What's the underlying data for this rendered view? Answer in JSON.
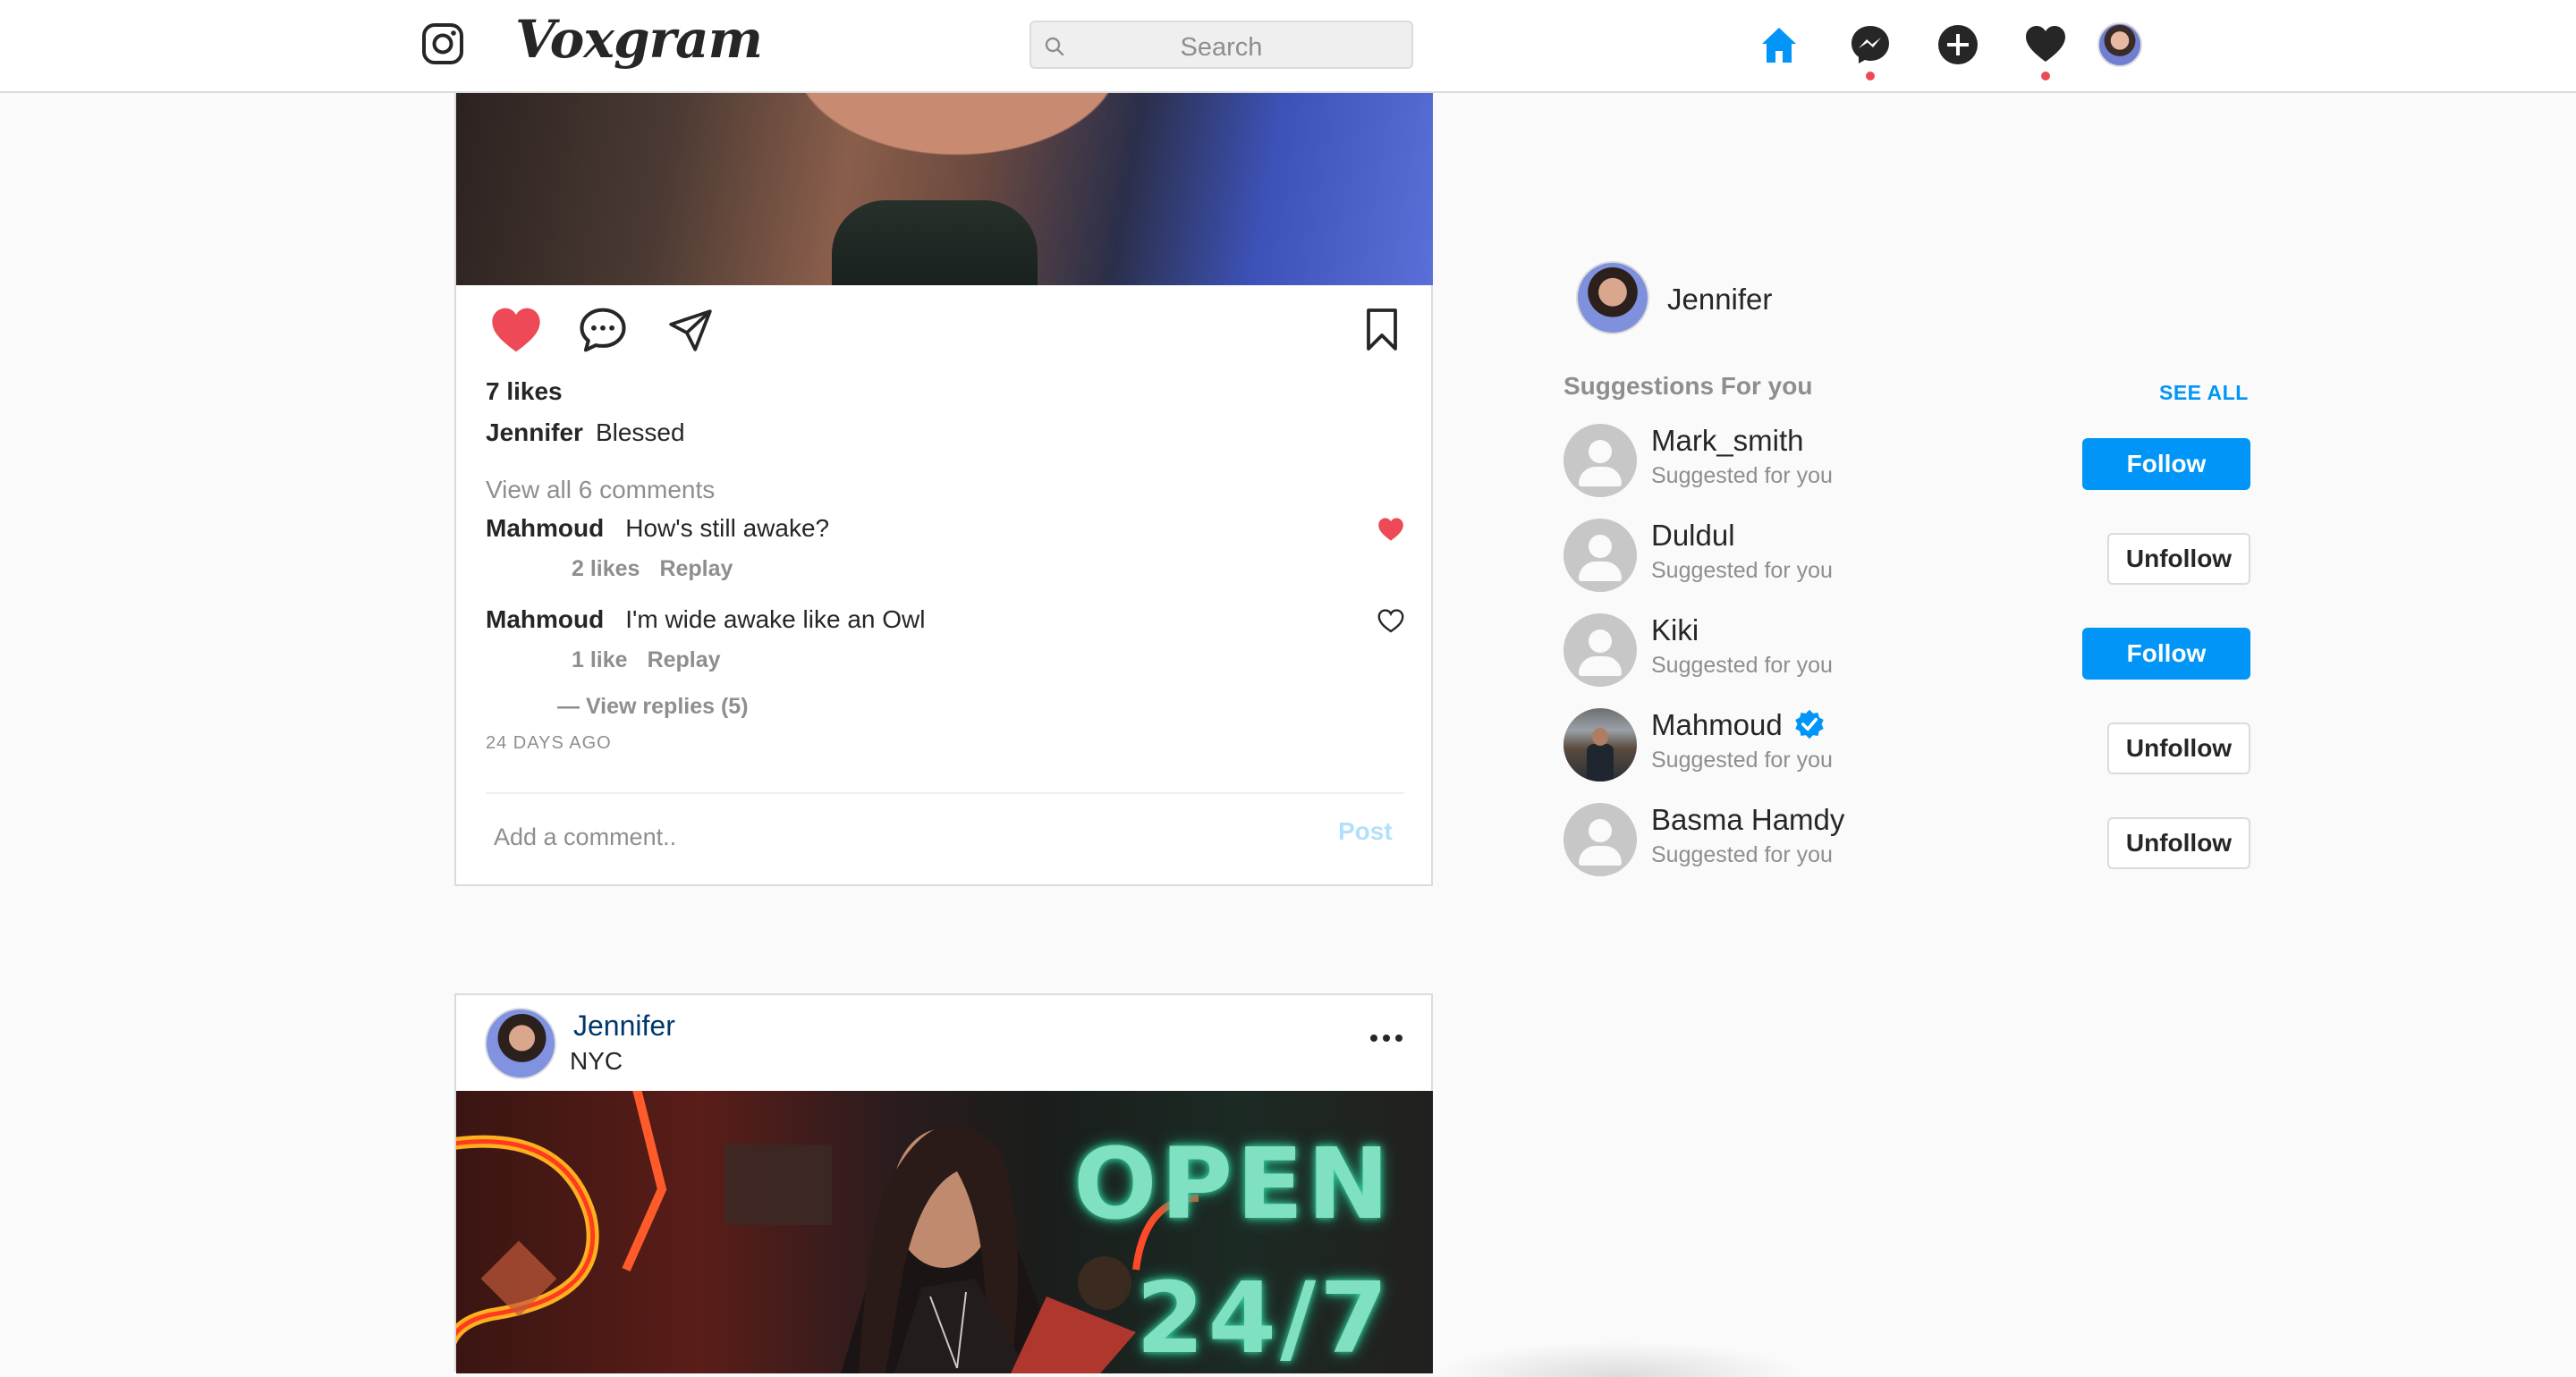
{
  "app": {
    "name": "Voxgram"
  },
  "search": {
    "placeholder": "Search"
  },
  "nav": {
    "icons": [
      "home-icon",
      "messenger-icon",
      "create-icon",
      "activity-heart-icon",
      "profile-avatar"
    ]
  },
  "post1": {
    "likes": "7 likes",
    "caption_user": "Jennifer",
    "caption_text": "Blessed",
    "view_all": "View all 6 comments",
    "comments": [
      {
        "user": "Mahmoud",
        "text": "How's still awake?",
        "likes": "2 likes",
        "reply": "Replay",
        "liked": true
      },
      {
        "user": "Mahmoud",
        "text": "I'm wide awake like an Owl",
        "likes": "1 like",
        "reply": "Replay",
        "liked": false
      }
    ],
    "view_replies": "— View replies (5)",
    "time_ago": "24 DAYS AGO",
    "add_comment_placeholder": "Add a comment..",
    "post_label": "Post"
  },
  "post2": {
    "user": "Jennifer",
    "location": "NYC",
    "sign_text_1": "OPEN",
    "sign_text_2": "24/7"
  },
  "sidebar": {
    "current_user": "Jennifer",
    "suggestions_title": "Suggestions For you",
    "see_all": "SEE ALL",
    "suggestions": [
      {
        "name": "Mark_smith",
        "sub": "Suggested for you",
        "action": "Follow",
        "verified": false
      },
      {
        "name": "Duldul",
        "sub": "Suggested for you",
        "action": "Unfollow",
        "verified": false
      },
      {
        "name": "Kiki",
        "sub": "Suggested for you",
        "action": "Follow",
        "verified": false
      },
      {
        "name": "Mahmoud",
        "sub": "Suggested for you",
        "action": "Unfollow",
        "verified": true
      },
      {
        "name": "Basma Hamdy",
        "sub": "Suggested for you",
        "action": "Unfollow",
        "verified": false
      }
    ]
  },
  "colors": {
    "accent": "#0095f6",
    "like_red": "#ed4956",
    "border": "#dbdbdb",
    "muted": "#8e8e8e",
    "background": "#fafafa"
  }
}
